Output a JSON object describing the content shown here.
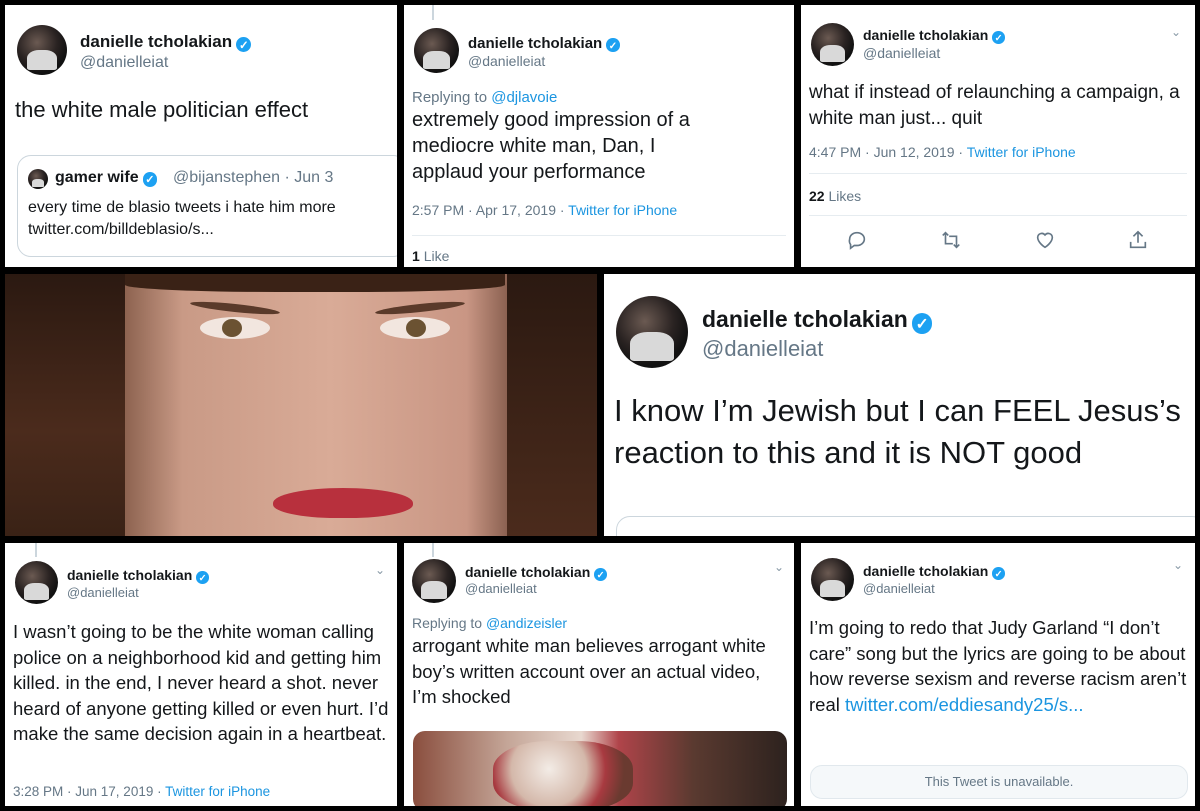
{
  "author": {
    "name": "danielle tcholakian",
    "handle": "@danielleiat"
  },
  "tweet1": {
    "text": "the white male politician effect",
    "quote": {
      "name": "gamer wife",
      "handle": "@bijanstephen",
      "date": "· Jun 3",
      "text": "every time de blasio tweets i hate him more",
      "link": "twitter.com/billdeblasio/s..."
    }
  },
  "tweet2": {
    "reply_prefix": "Replying to",
    "reply_to": "@djlavoie",
    "text": "extremely good impression of a mediocre white man, Dan, I applaud your performance",
    "time": "2:57 PM · Apr 17, 2019 ·",
    "source": "Twitter for iPhone",
    "likes_count": "1",
    "likes_label": "Like"
  },
  "tweet3": {
    "text": "what if instead of relaunching a campaign, a white man just... quit",
    "time": "4:47 PM · Jun 12, 2019 ·",
    "source": "Twitter for iPhone",
    "likes_count": "22",
    "likes_label": "Likes"
  },
  "tweet4": {
    "text": "I know I’m Jewish but I can FEEL Jesus’s reaction to this and it is NOT good"
  },
  "tweet5": {
    "text": "I wasn’t going to be the white woman calling police on a neighborhood kid and getting him killed. in the end, I never heard a shot. never heard of anyone getting killed or even hurt. I’d make the same decision again in a heartbeat.",
    "time": "3:28 PM · Jun 17, 2019 ·",
    "source": "Twitter for iPhone"
  },
  "tweet6": {
    "reply_prefix": "Replying to",
    "reply_to": "@andizeisler",
    "text": "arrogant white man believes arrogant white boy’s written account over an actual video, I’m shocked"
  },
  "tweet7": {
    "text": "I’m going to redo that Judy Garland “I don’t care” song but the lyrics are going to be about how reverse sexism and reverse racism aren’t real",
    "link": "twitter.com/eddiesandy25/s...",
    "unavailable": "This Tweet is unavailable."
  },
  "icons": [
    "reply-icon",
    "retweet-icon",
    "like-icon",
    "share-icon",
    "chevron-down-icon",
    "verified-icon"
  ],
  "colors": {
    "link": "#1b95e0",
    "verified": "#1da1f2",
    "muted": "#657786",
    "lips": "#b8303d"
  }
}
